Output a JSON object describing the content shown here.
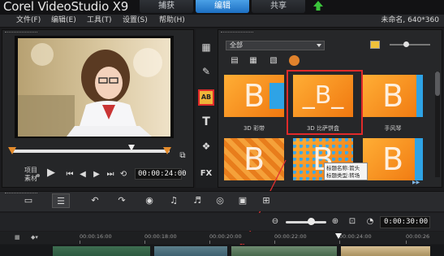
{
  "app": {
    "title": "Corel VideoStudio X9"
  },
  "main_tabs": [
    {
      "label": "捕获"
    },
    {
      "label": "编辑"
    },
    {
      "label": "共享"
    }
  ],
  "menu": {
    "items": [
      {
        "label": "文件(F)"
      },
      {
        "label": "编辑(E)"
      },
      {
        "label": "工具(T)"
      },
      {
        "label": "设置(S)"
      },
      {
        "label": "帮助(H)"
      }
    ],
    "project_info": "未命名, 640*360"
  },
  "preview": {
    "mode_project": "项目",
    "mode_clip": "素材",
    "timecode": "00:00:24:00"
  },
  "library": {
    "category": "全部",
    "thumbnails": [
      {
        "label": "3D 彩带"
      },
      {
        "label": "3D 比萨饼盒"
      },
      {
        "label": "手风琴"
      },
      {
        "label": ""
      },
      {
        "label": ""
      },
      {
        "label": ""
      }
    ],
    "tooltip": [
      "标题名称:箭头",
      "标题类型:转场"
    ]
  },
  "timeline": {
    "timecode": "0:00:30:00",
    "ruler": [
      "00:00:16:00",
      "00:00:18:00",
      "00:00:20:00",
      "00:00:22:00",
      "00:00:24:00",
      "00:00:26"
    ]
  },
  "colors": {
    "accent_blue": "#1d6fc2",
    "transition_orange": "#f07810",
    "selection_red": "#e02a2a"
  }
}
